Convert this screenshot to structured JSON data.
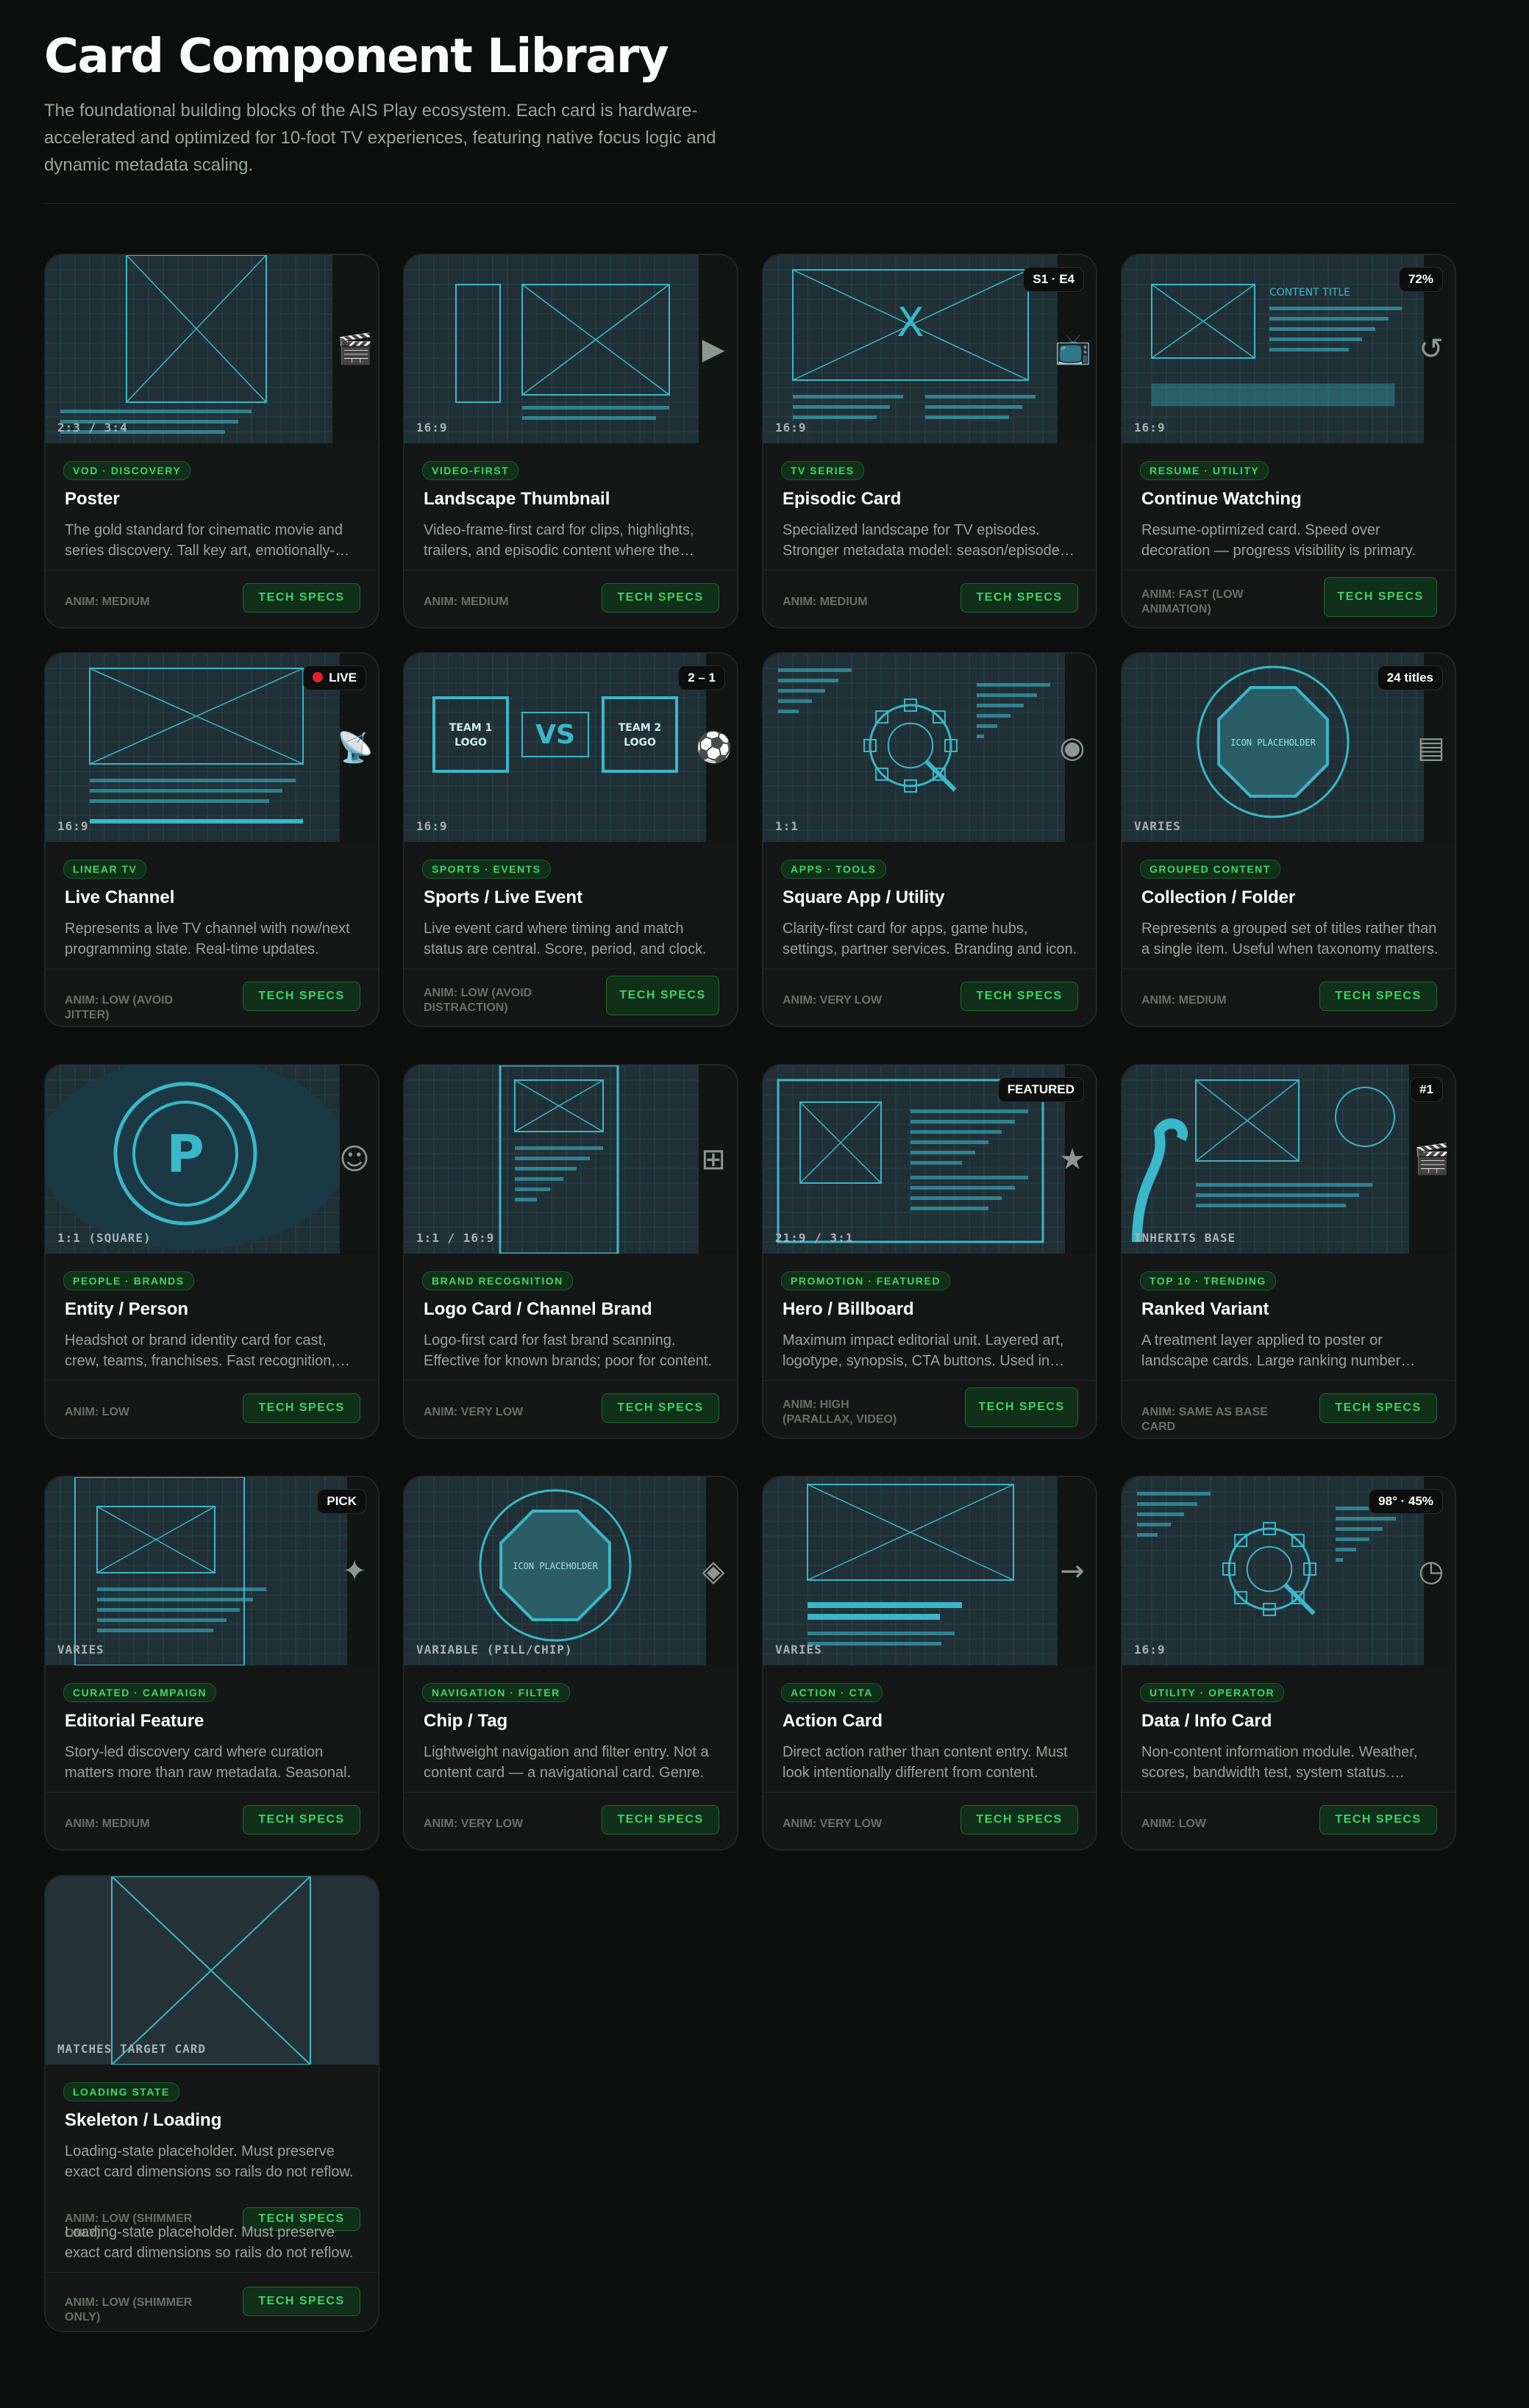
{
  "header": {
    "title": "Card Component Library",
    "subtitle": "The foundational building blocks of the AIS Play ecosystem. Each card is hardware-accelerated and optimized for 10-foot TV experiences, featuring native focus logic and dynamic metadata scaling."
  },
  "colors": {
    "accent": "#3fd366",
    "background": "#0c0f0d",
    "card": "#141715",
    "blueprint": "#2fb7c6",
    "live": "#e5222b"
  },
  "cards": [
    {
      "tag": "VOD · DISCOVERY",
      "name": "Poster",
      "desc": "The gold standard for cinematic movie and series discovery. Tall key art, emotionally-driven.",
      "anim": "ANIM: MEDIUM",
      "specs": "TECH SPECS",
      "corner": "2:3 / 3:4",
      "badge": "",
      "icon": "clapperboard-icon"
    },
    {
      "tag": "VIDEO-FIRST",
      "name": "Landscape Thumbnail",
      "desc": "Video-frame-first card for clips, highlights, trailers, and episodic content where the frame matters.",
      "anim": "ANIM: MEDIUM",
      "specs": "TECH SPECS",
      "corner": "16:9",
      "badge": "",
      "icon": "play-icon"
    },
    {
      "tag": "TV SERIES",
      "name": "Episodic Card",
      "desc": "Specialized landscape for TV episodes. Stronger metadata model: season/episode numbering.",
      "anim": "ANIM: MEDIUM",
      "specs": "TECH SPECS",
      "corner": "16:9",
      "badge": "S1 · E4",
      "icon": "tv-icon"
    },
    {
      "tag": "RESUME · UTILITY",
      "name": "Continue Watching",
      "desc": "Resume-optimized card. Speed over decoration — progress visibility is primary.",
      "anim": "ANIM: FAST (LOW ANIMATION)",
      "specs": "TECH SPECS",
      "corner": "16:9",
      "badge": "72%",
      "icon": "replay-icon"
    },
    {
      "tag": "LINEAR TV",
      "name": "Live Channel",
      "desc": "Represents a live TV channel with now/next programming state. Real-time updates.",
      "anim": "ANIM: LOW (AVOID JITTER)",
      "specs": "TECH SPECS",
      "corner": "16:9",
      "badge": "LIVE",
      "icon": "satellite-icon"
    },
    {
      "tag": "SPORTS · EVENTS",
      "name": "Sports / Live Event",
      "desc": "Live event card where timing and match status are central. Score, period, and clock.",
      "anim": "ANIM: LOW (AVOID DISTRACTION)",
      "specs": "TECH SPECS",
      "corner": "16:9",
      "badge": "2 – 1",
      "icon": "soccer-ball-icon"
    },
    {
      "tag": "APPS · TOOLS",
      "name": "Square App / Utility",
      "desc": "Clarity-first card for apps, game hubs, settings, partner services. Branding and icon.",
      "anim": "ANIM: VERY LOW",
      "specs": "TECH SPECS",
      "corner": "1:1",
      "badge": "",
      "icon": "record-icon"
    },
    {
      "tag": "GROUPED CONTENT",
      "name": "Collection / Folder",
      "desc": "Represents a grouped set of titles rather than a single item. Useful when taxonomy matters.",
      "anim": "ANIM: MEDIUM",
      "specs": "TECH SPECS",
      "corner": "VARIES",
      "badge": "24 titles",
      "icon": "list-icon"
    },
    {
      "tag": "PEOPLE · BRANDS",
      "name": "Entity / Person",
      "desc": "Headshot or brand identity card for cast, crew, teams, franchises. Fast recognition, minimal text.",
      "anim": "ANIM: LOW",
      "specs": "TECH SPECS",
      "corner": "1:1 (SQUARE)",
      "badge": "",
      "icon": "person-icon"
    },
    {
      "tag": "BRAND RECOGNITION",
      "name": "Logo Card / Channel Brand",
      "desc": "Logo-first card for fast brand scanning. Effective for known brands; poor for content.",
      "anim": "ANIM: VERY LOW",
      "specs": "TECH SPECS",
      "corner": "1:1 / 16:9",
      "badge": "",
      "icon": "grid-icon"
    },
    {
      "tag": "PROMOTION · FEATURED",
      "name": "Hero / Billboard",
      "desc": "Maximum impact editorial unit. Layered art, logotype, synopsis, CTA buttons. Used in heroes.",
      "anim": "ANIM: HIGH (PARALLAX, VIDEO)",
      "specs": "TECH SPECS",
      "corner": "21:9 / 3:1",
      "badge": "FEATURED",
      "icon": "star-icon"
    },
    {
      "tag": "TOP 10 · TRENDING",
      "name": "Ranked Variant",
      "desc": "A treatment layer applied to poster or landscape cards. Large ranking number overlaid.",
      "anim": "ANIM: SAME AS BASE CARD",
      "specs": "TECH SPECS",
      "corner": "INHERITS BASE",
      "badge": "#1",
      "icon": "clapperboard-icon"
    },
    {
      "tag": "CURATED · CAMPAIGN",
      "name": "Editorial Feature",
      "desc": "Story-led discovery card where curation matters more than raw metadata. Seasonal.",
      "anim": "ANIM: MEDIUM",
      "specs": "TECH SPECS",
      "corner": "VARIES",
      "badge": "PICK",
      "icon": "sparkle-icon"
    },
    {
      "tag": "NAVIGATION · FILTER",
      "name": "Chip / Tag",
      "desc": "Lightweight navigation and filter entry. Not a content card — a navigational card. Genre.",
      "anim": "ANIM: VERY LOW",
      "specs": "TECH SPECS",
      "corner": "VARIABLE (PILL/CHIP)",
      "badge": "",
      "icon": "diamond-icon"
    },
    {
      "tag": "ACTION · CTA",
      "name": "Action Card",
      "desc": "Direct action rather than content entry. Must look intentionally different from content.",
      "anim": "ANIM: VERY LOW",
      "specs": "TECH SPECS",
      "corner": "VARIES",
      "badge": "",
      "icon": "arrow-right-icon"
    },
    {
      "tag": "UTILITY · OPERATOR",
      "name": "Data / Info Card",
      "desc": "Non-content information module. Weather, scores, bandwidth test, system status. Modular.",
      "anim": "ANIM: LOW",
      "specs": "TECH SPECS",
      "corner": "16:9",
      "badge": "98° · 45%",
      "icon": "clock-icon"
    },
    {
      "tag": "LOADING STATE",
      "name": "Skeleton / Loading",
      "desc": "Loading-state placeholder. Must preserve exact card dimensions so rails do not reflow.",
      "anim": "ANIM: LOW (SHIMMER ONLY)",
      "specs": "TECH SPECS",
      "corner": "MATCHES TARGET CARD",
      "badge": "",
      "icon": ""
    }
  ],
  "skeleton_overlay": {
    "desc": "Loading-state placeholder. Must preserve exact card dimensions so rails do not reflow.",
    "anim": "ANIM: LOW (SHIMMER ONLY)",
    "specs": "TECH SPECS"
  },
  "art_labels": {
    "vs": "VS",
    "team1": "TEAM 1 LOGO",
    "team2": "TEAM 2 LOGO",
    "icon_placeholder": "ICON PLACEHOLDER",
    "content_title": "CONTENT TITLE",
    "x_mark": "X"
  }
}
